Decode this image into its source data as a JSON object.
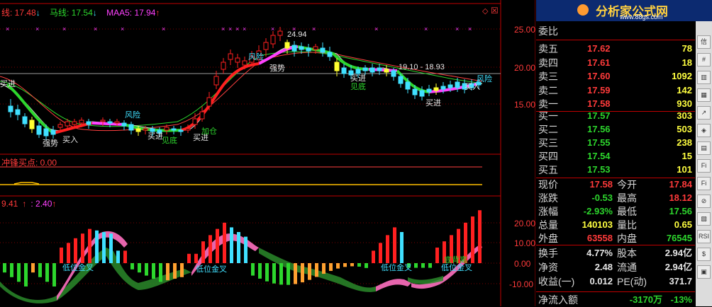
{
  "main_chart": {
    "ma_legend": [
      {
        "text": "线: 17.48",
        "arrow": "↓",
        "color": "#ffffff"
      },
      {
        "text": "马线: 17.54",
        "arrow": "↓",
        "color": "#2dd62d"
      },
      {
        "text": "MAA5: 17.94",
        "arrow": "↑",
        "color": "#ff40ff"
      }
    ],
    "y_axis": [
      "25.00",
      "20.00",
      "15.00"
    ],
    "annotations": {
      "peak": "24.94",
      "range": "19.10 - 18.93",
      "risk1": "风险",
      "risk2": "风险",
      "risk3": "风险",
      "risk4": "风险",
      "strong": "强势",
      "strong_left": "强势",
      "buy_in": "买入",
      "buy_in2": "买入",
      "buy_left": "买进",
      "buy1": "买进",
      "buy2": "买进",
      "buy3": "买进",
      "buy4": "买进",
      "see_bottom1": "见底",
      "see_bottom2": "见底",
      "add_pos": "加仓"
    }
  },
  "middle_chart": {
    "title": "冲锋买点: 0.00"
  },
  "macd_chart": {
    "legend1": "9.41",
    "legend1_arrow": "↑",
    "legend2": ": 2.40",
    "legend2_arrow": "↑",
    "y_axis": [
      "20.00",
      "10.00",
      "0.00",
      "-10.00"
    ],
    "labels": {
      "low_gold1": "低位金叉",
      "low_gold2": "低位金叉",
      "low_gold3": "低位金叉",
      "low_gold4": "低位金叉",
      "bottom_div": "底背离"
    }
  },
  "logo": {
    "title": "分析家公式网",
    "url": "www.88gs.com"
  },
  "quote": {
    "header": "委比",
    "asks": [
      {
        "name": "卖五",
        "price": "17.62",
        "vol": "78"
      },
      {
        "name": "卖四",
        "price": "17.61",
        "vol": "18"
      },
      {
        "name": "卖三",
        "price": "17.60",
        "vol": "1092"
      },
      {
        "name": "卖二",
        "price": "17.59",
        "vol": "142"
      },
      {
        "name": "卖一",
        "price": "17.58",
        "vol": "930"
      }
    ],
    "bids": [
      {
        "name": "买一",
        "price": "17.57",
        "vol": "303"
      },
      {
        "name": "买二",
        "price": "17.56",
        "vol": "503"
      },
      {
        "name": "买三",
        "price": "17.55",
        "vol": "238"
      },
      {
        "name": "买四",
        "price": "17.54",
        "vol": "15"
      },
      {
        "name": "买五",
        "price": "17.53",
        "vol": "101"
      }
    ],
    "stats": [
      {
        "l1": "现价",
        "v1": "17.58",
        "c1": "#ff3a3a",
        "l2": "今开",
        "v2": "17.84",
        "c2": "#ff3a3a"
      },
      {
        "l1": "涨跌",
        "v1": "-0.53",
        "c1": "#2dd62d",
        "l2": "最高",
        "v2": "18.12",
        "c2": "#ff3a3a"
      },
      {
        "l1": "涨幅",
        "v1": "-2.93%",
        "c1": "#2dd62d",
        "l2": "最低",
        "v2": "17.56",
        "c2": "#2dd62d"
      },
      {
        "l1": "总量",
        "v1": "140103",
        "c1": "#ffff40",
        "l2": "量比",
        "v2": "0.65",
        "c2": "#ffff40"
      },
      {
        "l1": "外盘",
        "v1": "63558",
        "c1": "#ff3a3a",
        "l2": "内盘",
        "v2": "76545",
        "c2": "#2dd62d"
      }
    ],
    "finance": [
      {
        "l1": "换手",
        "v1": "4.77%",
        "l2": "股本",
        "v2": "2.94亿"
      },
      {
        "l1": "净资",
        "v1": "2.48",
        "l2": "流通",
        "v2": "2.94亿"
      },
      {
        "l1": "收益(一)",
        "v1": "0.012",
        "l2": "PE(动)",
        "v2": "371.7"
      }
    ],
    "flow": {
      "label": "净流入额",
      "value": "-3170万",
      "pct": "-13%"
    }
  },
  "toolbar": {
    "buttons": [
      "信",
      "#",
      "▥",
      "▦",
      "↗",
      "◈",
      "▤",
      "Fi",
      "Fi",
      "⊘",
      "▧",
      "RSI",
      "$",
      "▣"
    ]
  }
}
